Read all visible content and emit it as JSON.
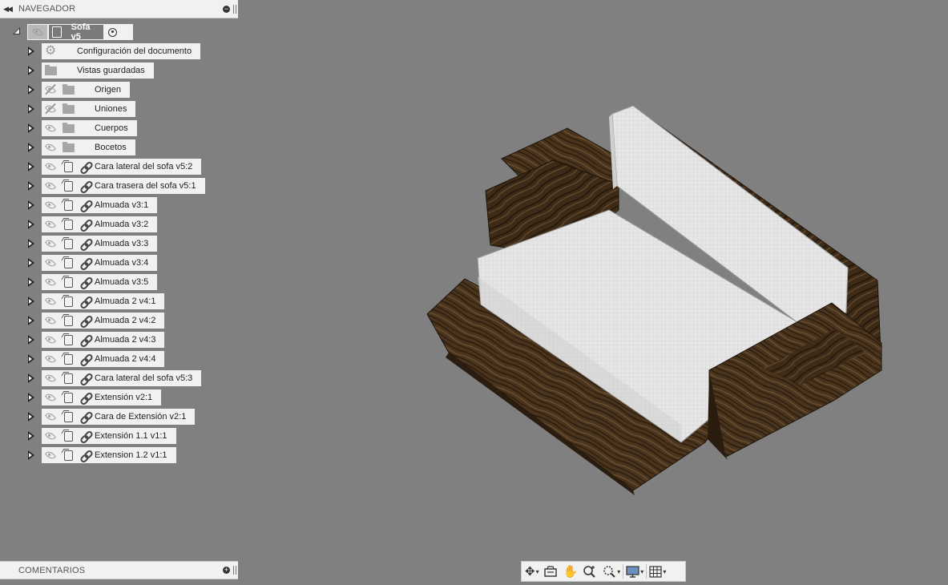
{
  "navigator": {
    "title": "NAVEGADOR",
    "root": {
      "name": "Sofa v5"
    },
    "items": [
      {
        "label": "Configuración del documento",
        "type": "settings"
      },
      {
        "label": "Vistas guardadas",
        "type": "folder"
      },
      {
        "label": "Origen",
        "type": "folder",
        "visible": false
      },
      {
        "label": "Uniones",
        "type": "folder",
        "visible": false
      },
      {
        "label": "Cuerpos",
        "type": "folder",
        "visible": true
      },
      {
        "label": "Bocetos",
        "type": "folder",
        "visible": true
      },
      {
        "label": "Cara lateral del sofa v5:2",
        "type": "component"
      },
      {
        "label": "Cara trasera del sofa v5:1",
        "type": "component"
      },
      {
        "label": "Almuada v3:1",
        "type": "component"
      },
      {
        "label": "Almuada v3:2",
        "type": "component"
      },
      {
        "label": "Almuada v3:3",
        "type": "component"
      },
      {
        "label": "Almuada v3:4",
        "type": "component"
      },
      {
        "label": "Almuada v3:5",
        "type": "component"
      },
      {
        "label": "Almuada 2 v4:1",
        "type": "component"
      },
      {
        "label": "Almuada 2 v4:2",
        "type": "component"
      },
      {
        "label": "Almuada 2 v4:3",
        "type": "component"
      },
      {
        "label": "Almuada 2 v4:4",
        "type": "component"
      },
      {
        "label": "Cara lateral del sofa v5:3",
        "type": "component"
      },
      {
        "label": "Extensión v2:1",
        "type": "component"
      },
      {
        "label": "Cara de Extensión v2:1",
        "type": "component"
      },
      {
        "label": "Extensión 1.1 v1:1",
        "type": "component"
      },
      {
        "label": "Extension 1.2 v1:1",
        "type": "component"
      }
    ]
  },
  "comments": {
    "title": "COMENTARIOS"
  },
  "toolbar": {
    "tools": [
      "orbit-icon",
      "look-at-icon",
      "pan-icon",
      "zoom-icon",
      "fit-icon",
      "display-settings-icon",
      "grid-icon"
    ]
  },
  "colors": {
    "viewport_bg": "#808080",
    "panel_bg": "#f1f1f1",
    "wood_dark": "#3b2a18",
    "wood_light": "#6b5233",
    "cushion": "#e3e3e3"
  }
}
